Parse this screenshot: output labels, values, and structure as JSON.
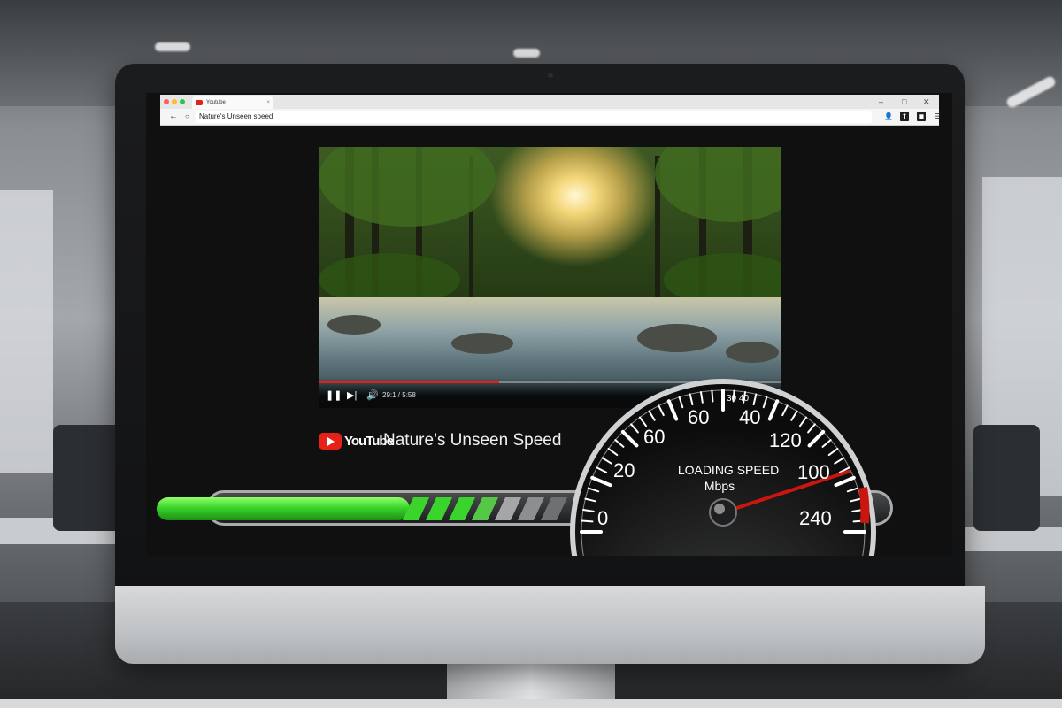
{
  "browser": {
    "tab_title": "Youtube",
    "tab_close": "×",
    "url": "Nature's Unseen speed",
    "back_icon": "←",
    "reload_icon": "○"
  },
  "video": {
    "time": "29:1 / 5:58",
    "progress": 0.39,
    "play_state": "playing"
  },
  "channel": {
    "logo_text": "YouTube"
  },
  "title": "Nature’s Unseen Speed",
  "loading_bar": {
    "fill_fraction": 0.42
  },
  "speedometer": {
    "label": "LOADING SPEED",
    "unit": "Mbps",
    "top_small": "30 40",
    "ticks": [
      "0",
      "20",
      "60",
      "60",
      "40",
      "120",
      "100",
      "240"
    ],
    "needle_value_fraction": 0.9
  },
  "colors": {
    "accent_green": "#3bd42c",
    "youtube_red": "#e62117",
    "needle_red": "#c9160e"
  }
}
